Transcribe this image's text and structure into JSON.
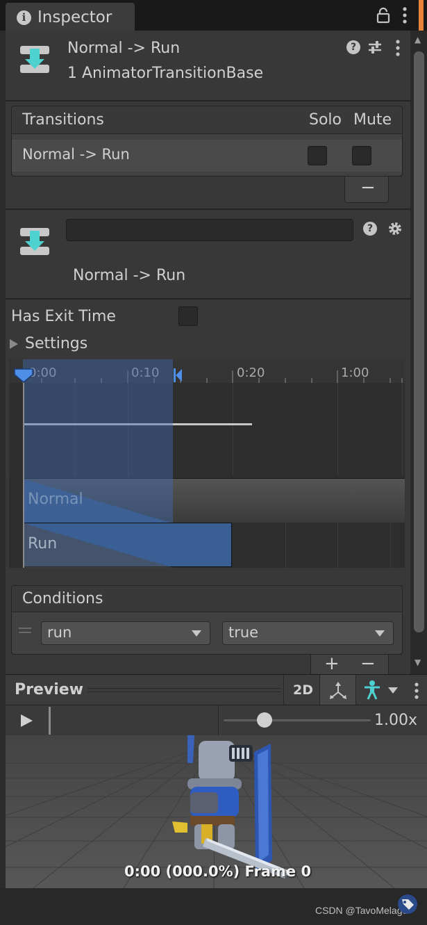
{
  "window": {
    "tab_title": "Inspector",
    "icons": [
      "info-icon",
      "lock-icon",
      "kebab-menu-icon"
    ],
    "accent": "#e8833a"
  },
  "header": {
    "title": "Normal -> Run",
    "subtitle": "1 AnimatorTransitionBase",
    "icons": [
      "transition-icon",
      "help-icon",
      "presets-icon",
      "kebab-menu-icon"
    ]
  },
  "transitions": {
    "header_label": "Transitions",
    "col_solo": "Solo",
    "col_mute": "Mute",
    "rows": [
      {
        "name": "Normal -> Run",
        "solo": false,
        "mute": false
      }
    ],
    "remove_label": "−"
  },
  "transition": {
    "name_value": "",
    "caption": "Normal -> Run",
    "icons": [
      "transition-icon",
      "help-icon",
      "gear-icon"
    ],
    "has_exit_time_label": "Has Exit Time",
    "has_exit_time": false,
    "settings_label": "Settings"
  },
  "timeline": {
    "ticks": [
      "0:00",
      "0:10",
      "0:20",
      "1:00"
    ],
    "clips": [
      "Normal",
      "Run"
    ],
    "selection_color": "#406aaa"
  },
  "conditions": {
    "header_label": "Conditions",
    "rows": [
      {
        "parameter": "run",
        "value": "true"
      }
    ],
    "add_label": "+",
    "remove_label": "−"
  },
  "preview": {
    "title": "Preview",
    "mode_2d": "2D",
    "speed": "1.00x",
    "speed_fraction": 0.28,
    "status": "0:00 (000.0%) Frame 0",
    "icons": [
      "play-icon",
      "pivot-icon",
      "avatar-icon",
      "chevron-down-icon",
      "kebab-menu-icon",
      "tag-icon"
    ]
  },
  "watermark": "CSDN @TavoMelage"
}
